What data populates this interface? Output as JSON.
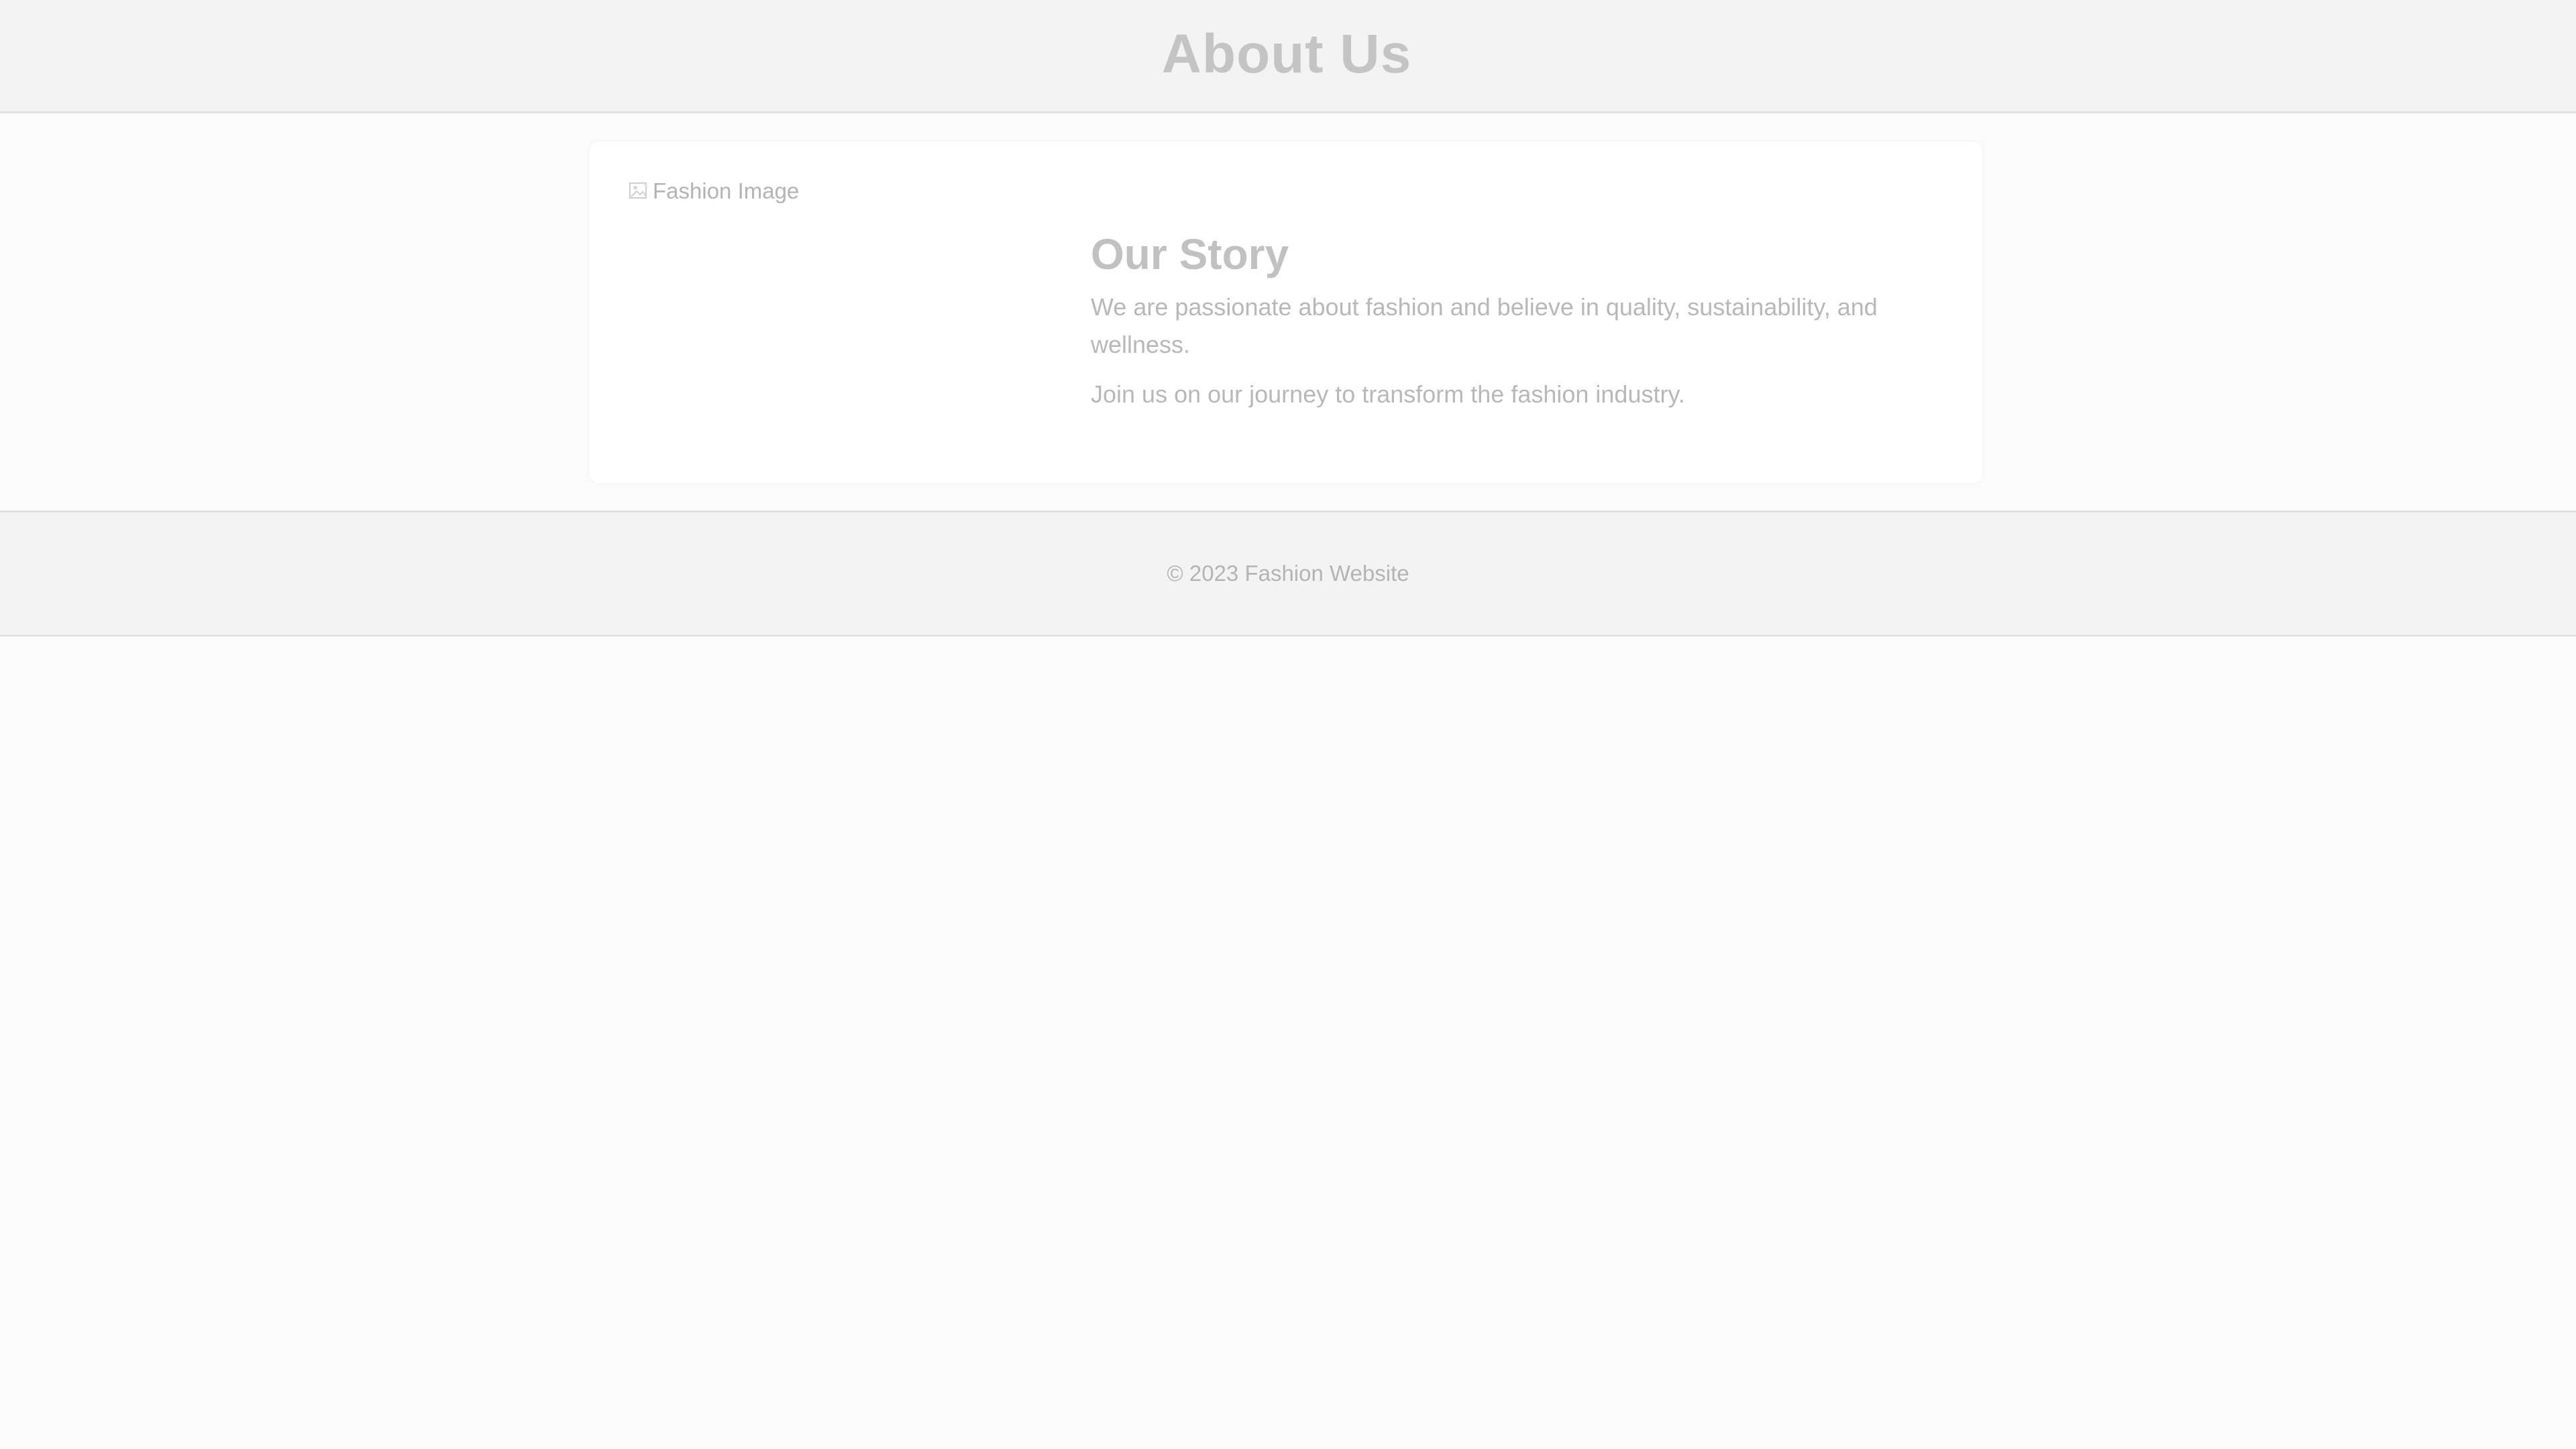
{
  "header": {
    "title": "About Us"
  },
  "card": {
    "image_alt": "Fashion Image",
    "image_icon": "broken-image-icon",
    "heading": "Our Story",
    "paragraphs": [
      "We are passionate about fashion and believe in quality, sustainability, and wellness.",
      "Join us on our journey to transform the fashion industry."
    ]
  },
  "footer": {
    "text": "© 2023 Fashion Website"
  },
  "colors": {
    "page_background": "#fbfbfb",
    "header_background": "#f3f3f3",
    "card_background": "#ffffff",
    "text_muted": "#b8b8b8"
  }
}
